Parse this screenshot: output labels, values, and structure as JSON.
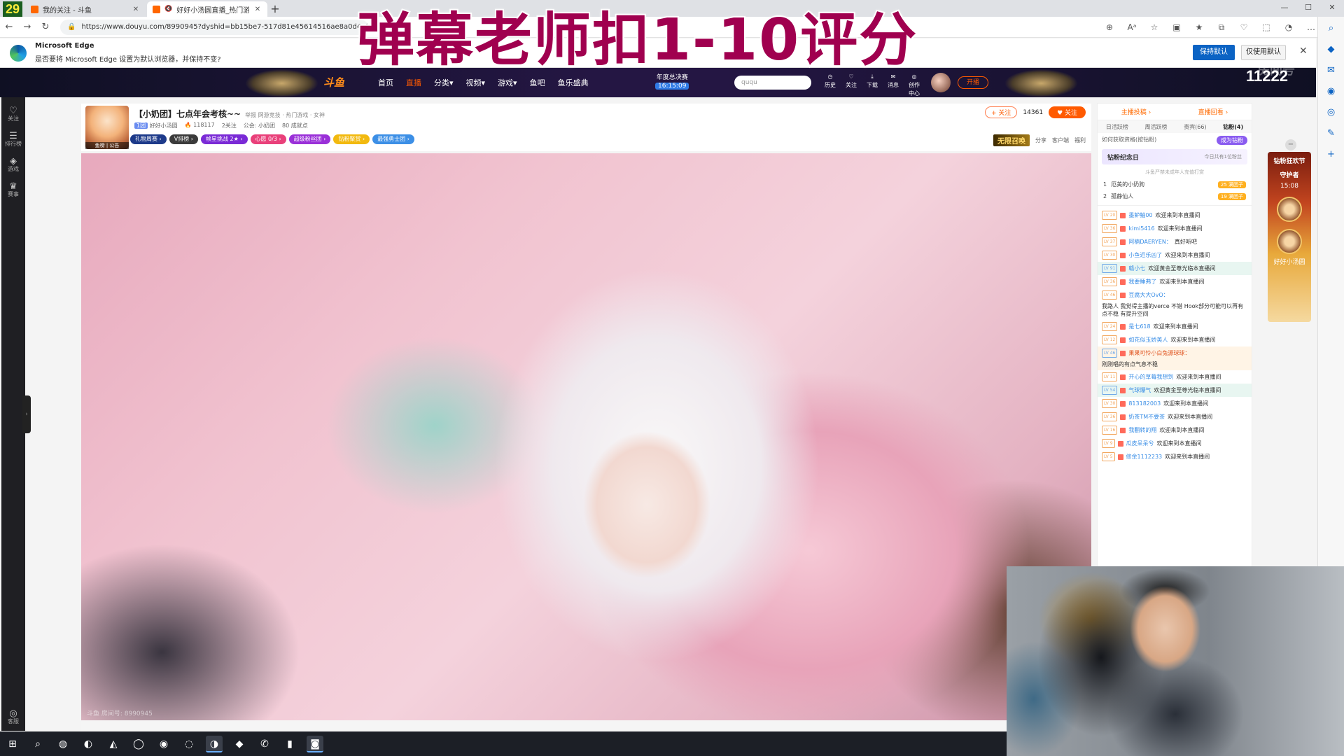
{
  "corner_badge": "29",
  "browser": {
    "tabs": [
      {
        "title": "我的关注 - 斗鱼",
        "active": false
      },
      {
        "title": "好好小汤圆直播_热门游戏直播",
        "active": true
      }
    ],
    "new_tab": "+",
    "url": "https://www.douyu.com/8990945?dyshid=bb15be7-517d81e45614516ae8a0d4ef000916",
    "window_controls": [
      "—",
      "☐",
      "✕"
    ]
  },
  "infobar": {
    "title": "Microsoft Edge",
    "message": "是否要将 Microsoft Edge 设置为默认浏览器，并保持不变?",
    "primary_button": "保持默认",
    "secondary_button": "仅使用默认",
    "close": "✕"
  },
  "overlay_title": "弹幕老师扣1-10评分",
  "douyu": {
    "logo": "斗鱼",
    "nav": [
      {
        "label": "首页",
        "active": false
      },
      {
        "label": "直播",
        "active": true
      },
      {
        "label": "分类▾",
        "active": false
      },
      {
        "label": "视频▾",
        "active": false
      },
      {
        "label": "游戏▾",
        "active": false
      },
      {
        "label": "鱼吧",
        "active": false
      },
      {
        "label": "鱼乐盛典",
        "active": false
      }
    ],
    "year_event": {
      "label": "年度总决赛",
      "time": "16:15:09"
    },
    "search_placeholder": "ququ",
    "header_icons": [
      "历史",
      "关注",
      "下载",
      "消息",
      "创作中心"
    ],
    "live_button": "开播",
    "viewer_count": "11222",
    "viewer_label_faded": "房间号"
  },
  "sidebar": [
    {
      "icon": "♡",
      "label": "关注"
    },
    {
      "icon": "☰",
      "label": "排行榜"
    },
    {
      "icon": "◈",
      "label": "游戏"
    },
    {
      "icon": "♛",
      "label": "赛事"
    }
  ],
  "sidebar_bottom": {
    "icon": "◎",
    "label": "客服"
  },
  "room": {
    "avatar_label": "鱼榜 | 公告",
    "title": "【小奶团】七点年会考核~~",
    "title_suffix": "举报  网游竞技 · 热门游戏 · 女神",
    "level": "1团",
    "streamer": "好好小汤圆",
    "heat": "118117",
    "follows": "2关注",
    "notice": "公会: 小奶团",
    "extra": "80 成就点",
    "badges": [
      {
        "label": "礼物周赛 ›",
        "color": "#1d3a8a"
      },
      {
        "label": "V排榜 ›",
        "color": "#3b3b3b"
      },
      {
        "label": "帧星挑战 2★ ›",
        "color": "#7a2ad6"
      },
      {
        "label": "心愿 0/3 ›",
        "color": "#e9407a"
      },
      {
        "label": "超级粉丝团 ›",
        "color": "#9a30d8"
      },
      {
        "label": "钻粉聚赏 ›",
        "color": "#f2b90f"
      },
      {
        "label": "最强勇士团 ›",
        "color": "#3c8fe6"
      }
    ],
    "report": "+ 关注",
    "fans": "14361",
    "follow": "♥ 关注",
    "promo": "无限召唤",
    "share": "分享",
    "client": "客户端",
    "more": "福利"
  },
  "video": {
    "room_number_text": "斗鱼 房间号: 8990945"
  },
  "right_panel": {
    "tabs": [
      "主播投稿 ›",
      "直播回看 ›"
    ],
    "subtabs": [
      {
        "label": "日活跃榜",
        "active": false
      },
      {
        "label": "周活跃榜",
        "active": false
      },
      {
        "label": "贵宾(66)",
        "active": false
      },
      {
        "label": "钻粉(4)",
        "active": true
      }
    ],
    "info_text": "如何获取资格(按钻粉)",
    "info_pill": "成为钻粉",
    "anniversary_title": "钻粉纪念日",
    "anniversary_sub": "今日共有1位粉丝",
    "hint": "斗鱼严禁未成年人充值打赏",
    "ranks": [
      {
        "no": "1",
        "name": "厄美的小奶狗",
        "tag": "25 满团子"
      },
      {
        "no": "2",
        "name": "孤静仙人",
        "tag": "19 满团子"
      }
    ],
    "chat": [
      {
        "lv": "LV 20",
        "user": "墨鲈鲉00",
        "text": "欢迎来到本直播间",
        "style": ""
      },
      {
        "lv": "LV 36",
        "user": "kimi5416",
        "text": "欢迎来到本直播间",
        "style": ""
      },
      {
        "lv": "LV 37",
        "user": "阿楠DAERYEN：",
        "text": "真好听吧",
        "style": ""
      },
      {
        "lv": "LV 30",
        "user": "小鱼近乐凶了",
        "text": "欢迎来到本直播间",
        "style": ""
      },
      {
        "lv": "LV 91",
        "user": "赣小七",
        "text": "欢迎黄金至尊光临本直播间",
        "style": "vip"
      },
      {
        "lv": "LV 36",
        "user": "我要睡弗了",
        "text": "欢迎来到本直播间",
        "style": ""
      },
      {
        "lv": "LV 46",
        "user": "豆腐大大OvO：",
        "text": "我路人 我觉得主播的verce 不错 Hook部分可能可以再有点不稳 有提升空间",
        "style": ""
      },
      {
        "lv": "LV 24",
        "user": "是七618",
        "text": "欢迎来到本直播间",
        "style": ""
      },
      {
        "lv": "LV 12",
        "user": "如花似玉娇美人",
        "text": "欢迎来到本直播间",
        "style": ""
      },
      {
        "lv": "LV 46",
        "user": "果果可怜小白兔源球球：",
        "text": "刚刚唱的有点气息不稳",
        "style": "vip2"
      },
      {
        "lv": "LV 11",
        "user": "开心的草莓我想到",
        "text": "欢迎来到本直播间",
        "style": ""
      },
      {
        "lv": "LV 54",
        "user": "气球爆气",
        "text": "欢迎黄金至尊光临本直播间",
        "style": "vip"
      },
      {
        "lv": "LV 30",
        "user": "813182003",
        "text": "欢迎来到本直播间",
        "style": ""
      },
      {
        "lv": "LV 36",
        "user": "奶茶TM不要茶",
        "text": "欢迎来到本直播间",
        "style": ""
      },
      {
        "lv": "LV 16",
        "user": "我翻转的翔",
        "text": "欢迎来到本直播间",
        "style": ""
      },
      {
        "lv": "LV 9",
        "user": "瓜皮呆呆兮",
        "text": "欢迎来到本直播间",
        "style": ""
      },
      {
        "lv": "LV 5",
        "user": "修余1112233",
        "text": "欢迎来到本直播间",
        "style": ""
      }
    ]
  },
  "right_ad": {
    "title": "钻粉狂欢节",
    "subtitle": "守护者",
    "time": "15:08",
    "caption": "好好小汤圆"
  },
  "edge_side_icons": [
    "⌕",
    "◆",
    "✉",
    "◉",
    "◎",
    "✎",
    "+"
  ],
  "toolbar_icons": [
    "⊕",
    "Aᵃ",
    "☆",
    "▣",
    "★",
    "⧉",
    "♡",
    "⬚",
    "◔",
    "…"
  ],
  "taskbar_icons": [
    "⊞",
    "⌕",
    "◍",
    "◐",
    "◭",
    "◯",
    "◉",
    "◌",
    "◑",
    "◆",
    "✆",
    "▮",
    "◙"
  ]
}
